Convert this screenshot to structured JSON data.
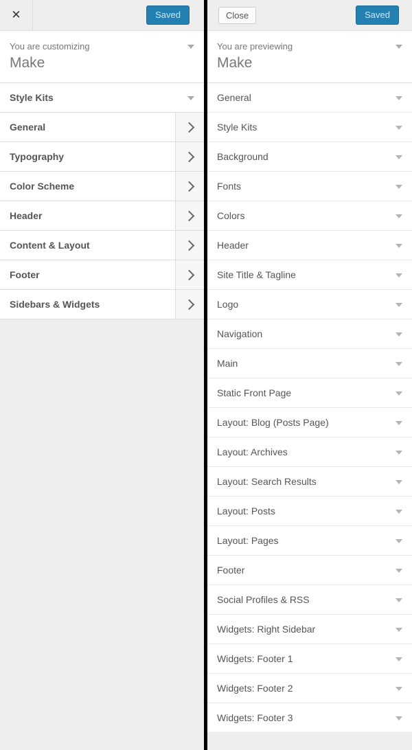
{
  "left_panel": {
    "header": {
      "close_icon": "close-icon",
      "close_label": "✕",
      "save_label": "Saved"
    },
    "info": {
      "subtitle": "You are customizing",
      "title": "Make",
      "caret_icon": "caret-down-icon"
    },
    "items": [
      {
        "label": "Style Kits",
        "indicator": "caret-down-icon",
        "type": "caret"
      },
      {
        "label": "General",
        "indicator": "chevron-right-icon",
        "type": "chevron"
      },
      {
        "label": "Typography",
        "indicator": "chevron-right-icon",
        "type": "chevron"
      },
      {
        "label": "Color Scheme",
        "indicator": "chevron-right-icon",
        "type": "chevron"
      },
      {
        "label": "Header",
        "indicator": "chevron-right-icon",
        "type": "chevron"
      },
      {
        "label": "Content & Layout",
        "indicator": "chevron-right-icon",
        "type": "chevron"
      },
      {
        "label": "Footer",
        "indicator": "chevron-right-icon",
        "type": "chevron"
      },
      {
        "label": "Sidebars & Widgets",
        "indicator": "chevron-right-icon",
        "type": "chevron"
      }
    ]
  },
  "right_panel": {
    "header": {
      "close_label": "Close",
      "save_label": "Saved"
    },
    "info": {
      "subtitle": "You are previewing",
      "title": "Make",
      "caret_icon": "caret-down-icon"
    },
    "items": [
      {
        "label": "General",
        "indicator": "caret-down-icon"
      },
      {
        "label": "Style Kits",
        "indicator": "caret-down-icon"
      },
      {
        "label": "Background",
        "indicator": "caret-down-icon"
      },
      {
        "label": "Fonts",
        "indicator": "caret-down-icon"
      },
      {
        "label": "Colors",
        "indicator": "caret-down-icon"
      },
      {
        "label": "Header",
        "indicator": "caret-down-icon"
      },
      {
        "label": "Site Title & Tagline",
        "indicator": "caret-down-icon"
      },
      {
        "label": "Logo",
        "indicator": "caret-down-icon"
      },
      {
        "label": "Navigation",
        "indicator": "caret-down-icon"
      },
      {
        "label": "Main",
        "indicator": "caret-down-icon"
      },
      {
        "label": "Static Front Page",
        "indicator": "caret-down-icon"
      },
      {
        "label": "Layout: Blog (Posts Page)",
        "indicator": "caret-down-icon"
      },
      {
        "label": "Layout: Archives",
        "indicator": "caret-down-icon"
      },
      {
        "label": "Layout: Search Results",
        "indicator": "caret-down-icon"
      },
      {
        "label": "Layout: Posts",
        "indicator": "caret-down-icon"
      },
      {
        "label": "Layout: Pages",
        "indicator": "caret-down-icon"
      },
      {
        "label": "Footer",
        "indicator": "caret-down-icon"
      },
      {
        "label": "Social Profiles & RSS",
        "indicator": "caret-down-icon"
      },
      {
        "label": "Widgets: Right Sidebar",
        "indicator": "caret-down-icon"
      },
      {
        "label": "Widgets: Footer 1",
        "indicator": "caret-down-icon"
      },
      {
        "label": "Widgets: Footer 2",
        "indicator": "caret-down-icon"
      },
      {
        "label": "Widgets: Footer 3",
        "indicator": "caret-down-icon"
      }
    ]
  },
  "colors": {
    "accent_blue": "#2580b2",
    "panel_bg": "#eeeeee",
    "row_bg": "#ffffff",
    "text": "#555555",
    "muted_text": "#777777",
    "border": "#dddddd",
    "divider": "#000000"
  }
}
